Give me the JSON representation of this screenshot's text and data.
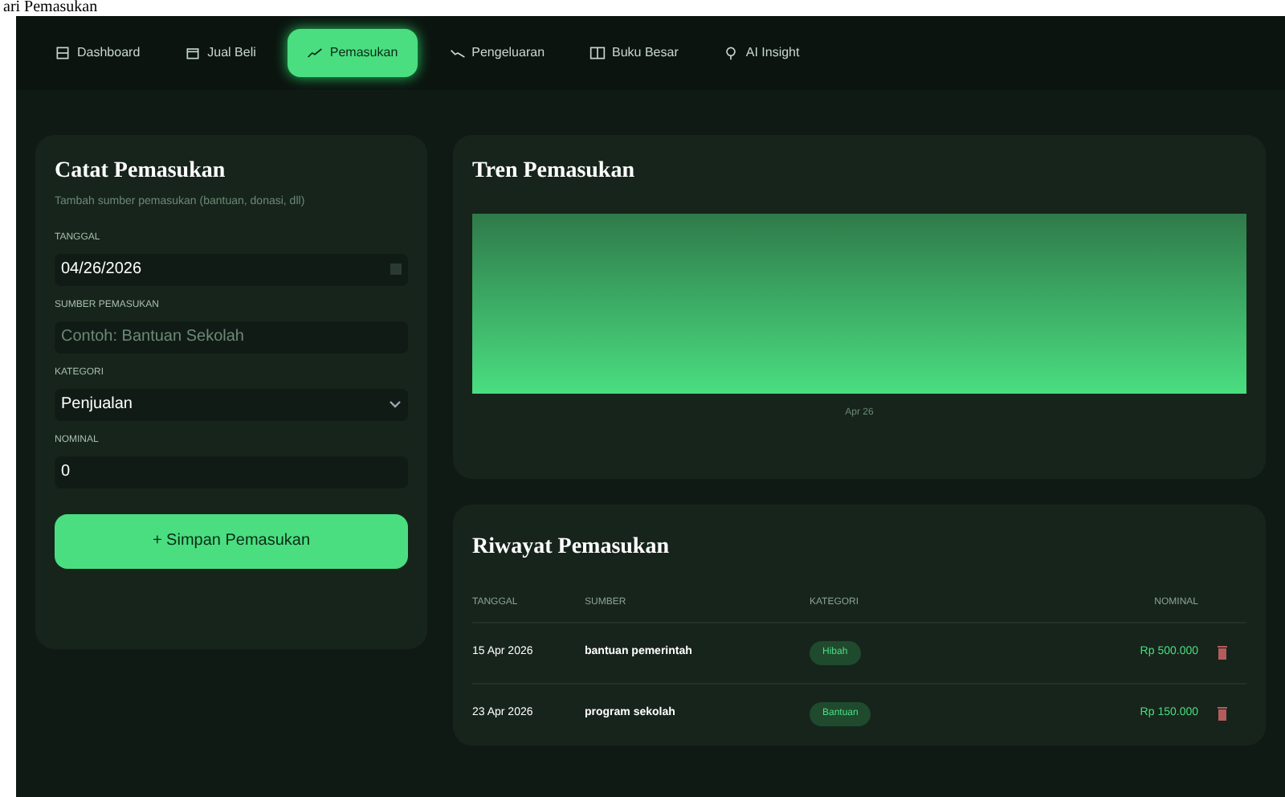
{
  "page_heading": "ari Pemasukan",
  "nav": [
    {
      "label": "Dashboard",
      "selected": false
    },
    {
      "label": "Jual Beli",
      "selected": false
    },
    {
      "label": "Pemasukan",
      "selected": true
    },
    {
      "label": "Pengeluaran",
      "selected": false
    },
    {
      "label": "Buku Besar",
      "selected": false
    },
    {
      "label": "AI Insight",
      "selected": false
    }
  ],
  "form": {
    "title": "Catat Pemasukan",
    "subtitle": "Tambah sumber pemasukan (bantuan, donasi, dll)",
    "fields": [
      {
        "label": "TANGGAL",
        "kind": "date",
        "value": "04/26/2026"
      },
      {
        "label": "SUMBER PEMASUKAN",
        "kind": "text",
        "placeholder": "Contoh: Bantuan Sekolah"
      },
      {
        "label": "KATEGORI",
        "kind": "select",
        "value": "Penjualan"
      },
      {
        "label": "NOMINAL",
        "kind": "number",
        "value": "0"
      }
    ],
    "submit": "+ Simpan Pemasukan"
  },
  "trend": {
    "title": "Tren Pemasukan",
    "x_label": "Apr 26"
  },
  "history": {
    "title": "Riwayat Pemasukan",
    "columns": [
      "TANGGAL",
      "SUMBER",
      "KATEGORI",
      "NOMINAL"
    ],
    "rows": [
      {
        "date": "15 Apr 2026",
        "source": "bantuan pemerintah",
        "category": "Hibah",
        "amount": "Rp 500.000"
      },
      {
        "date": "23 Apr 2026",
        "source": "program sekolah",
        "category": "Bantuan",
        "amount": "Rp 150.000"
      }
    ]
  }
}
